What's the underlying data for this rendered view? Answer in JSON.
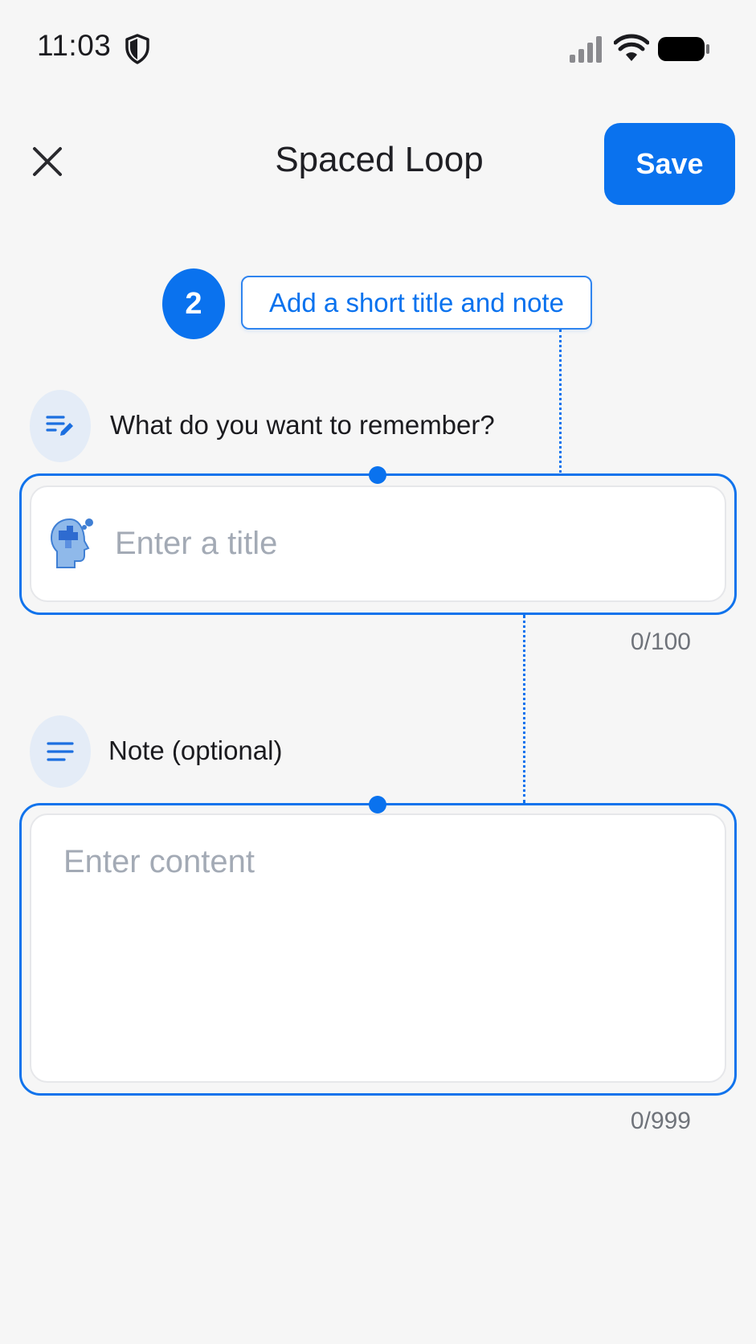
{
  "status_bar": {
    "time": "11:03",
    "icons": [
      "shield-icon",
      "signal-icon",
      "wifi-icon",
      "battery-icon"
    ]
  },
  "header": {
    "close_icon": "close-icon",
    "title": "Spaced Loop",
    "save_label": "Save"
  },
  "step": {
    "number": "2",
    "tip": "Add a short title and note"
  },
  "title_section": {
    "label": "What do you want to remember?",
    "label_icon": "edit-lines-icon",
    "field_icon": "brain-puzzle-icon",
    "placeholder": "Enter a title",
    "value": "",
    "counter": "0/100"
  },
  "note_section": {
    "label": "Note (optional)",
    "label_icon": "text-lines-icon",
    "placeholder": "Enter content",
    "value": "",
    "counter": "0/999"
  },
  "colors": {
    "accent": "#0a72ee",
    "background": "#f6f6f6",
    "placeholder": "#a3aab5",
    "label_icon_bg": "#e4ecf7"
  }
}
